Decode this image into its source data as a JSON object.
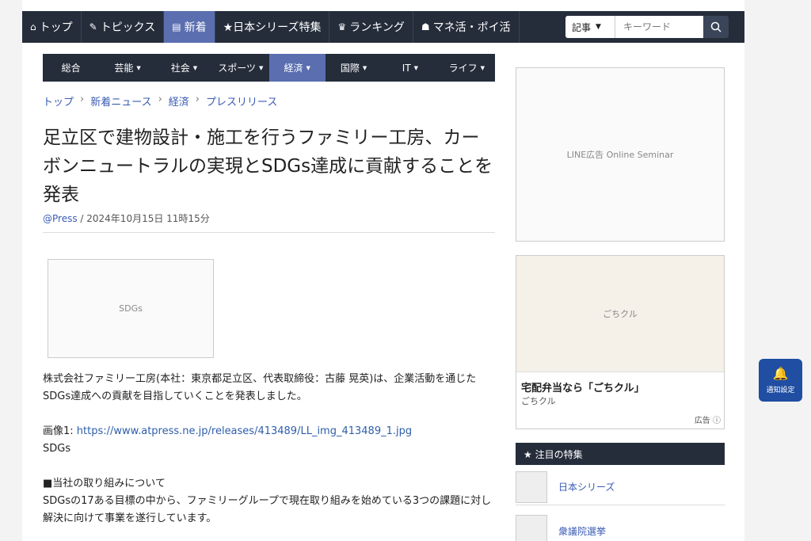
{
  "top_nav": [
    {
      "icon": "home-icon",
      "glyph": "⌂",
      "label": "トップ",
      "active": false
    },
    {
      "icon": "pencil-icon",
      "glyph": "✎",
      "label": "トピックス",
      "active": false
    },
    {
      "icon": "document-icon",
      "glyph": "▤",
      "label": "新着",
      "active": true
    },
    {
      "icon": "",
      "glyph": "",
      "label": "★日本シリーズ特集",
      "active": false
    },
    {
      "icon": "crown-icon",
      "glyph": "♛",
      "label": "ランキング",
      "active": false
    },
    {
      "icon": "coin-bag-icon",
      "glyph": "☗",
      "label": "マネ活・ポイ活",
      "active": false
    }
  ],
  "search": {
    "scope": "記事",
    "placeholder": "キーワード"
  },
  "categories": [
    {
      "label": "総合",
      "caret": false,
      "active": false
    },
    {
      "label": "芸能",
      "caret": true,
      "active": false
    },
    {
      "label": "社会",
      "caret": true,
      "active": false
    },
    {
      "label": "スポーツ",
      "caret": true,
      "active": false
    },
    {
      "label": "経済",
      "caret": true,
      "active": true
    },
    {
      "label": "国際",
      "caret": true,
      "active": false
    },
    {
      "label": "IT",
      "caret": true,
      "active": false
    },
    {
      "label": "ライフ",
      "caret": true,
      "active": false
    }
  ],
  "breadcrumb": [
    "トップ",
    "新着ニュース",
    "経済",
    "プレスリリース"
  ],
  "article": {
    "title": "足立区で建物設計・施工を行うファミリー工房、カーボンニュートラルの実現とSDGs達成に貢献することを発表",
    "source": "@Press",
    "date": " / 2024年10月15日 11時15分",
    "image_alt": "SDGs",
    "p1": "株式会社ファミリー工房(本社：東京都足立区、代表取締役：古藤 晃英)は、企業活動を通じたSDGs達成への貢献を目指していくことを発表しました。",
    "image_label": "画像1: ",
    "image_link": "https://www.atpress.ne.jp/releases/413489/LL_img_413489_1.jpg",
    "image_caption": "SDGs",
    "section": "■当社の取り組みについて",
    "p2": "SDGsの17ある目標の中から、ファミリーグループで現在取り組みを始めている3つの課題に対し解決に向けて事業を遂行しています。"
  },
  "ads": {
    "line_ad_label": "LINE広告 Online Seminar",
    "bento": {
      "image_label": "ごちクル",
      "headline": "宅配弁当なら「ごちクル」",
      "sponsor": "ごちクル",
      "ad_label": "広告 ⓘ"
    }
  },
  "features": {
    "heading": "★ 注目の特集",
    "items": [
      "日本シリーズ",
      "衆議院選挙"
    ]
  },
  "notify": {
    "label": "通知設定"
  }
}
